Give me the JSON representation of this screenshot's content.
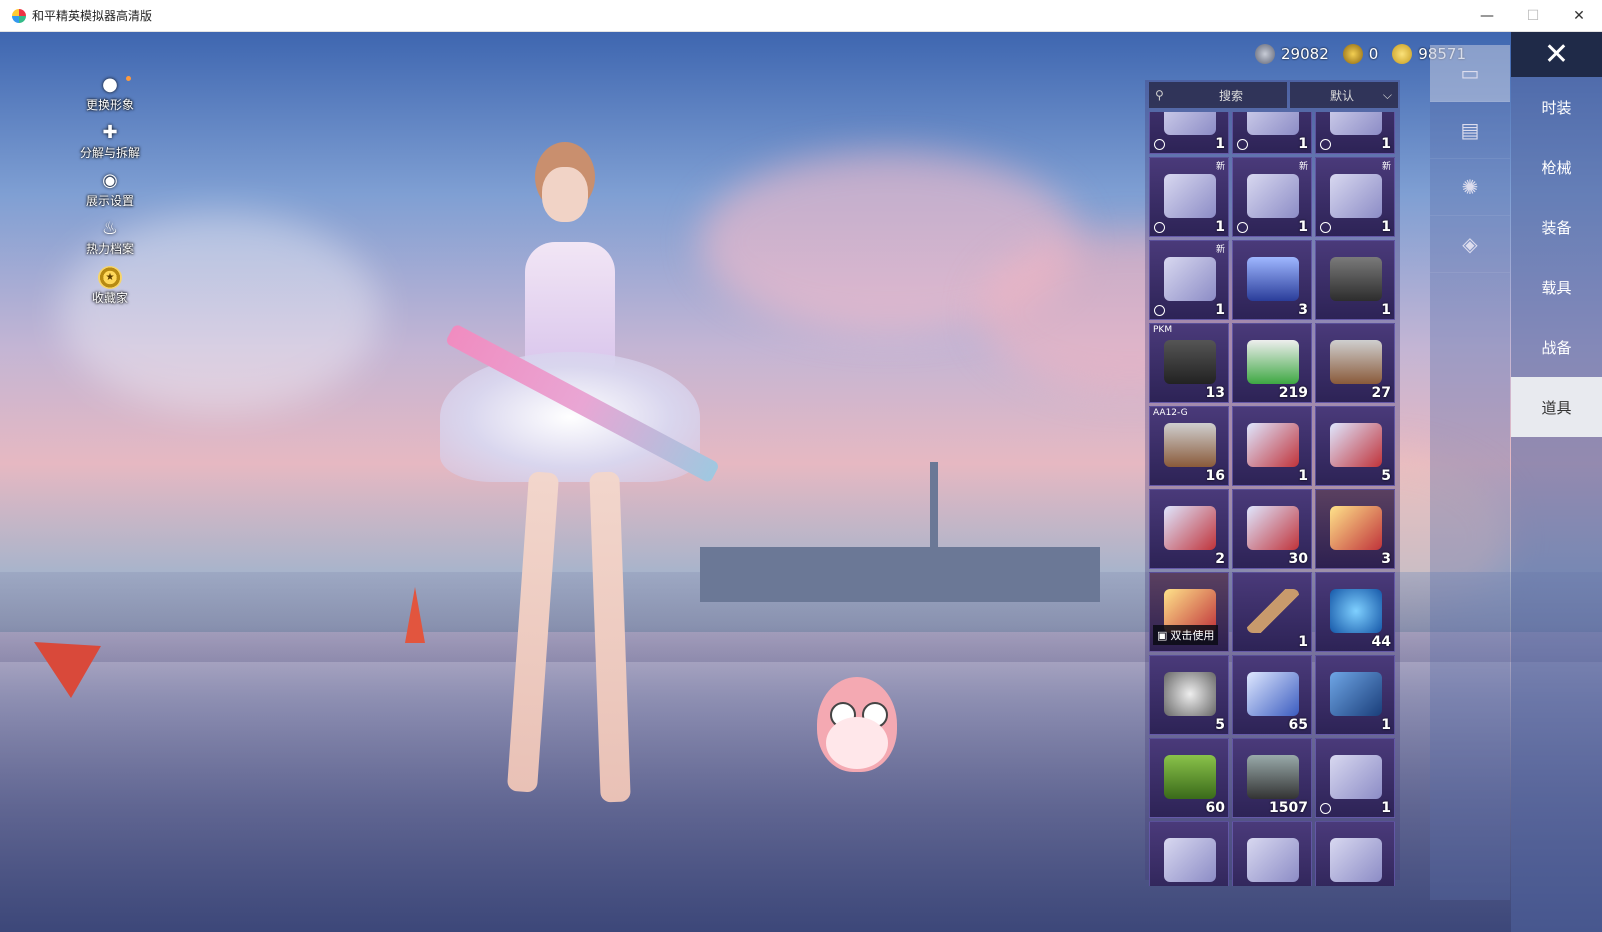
{
  "window": {
    "title": "和平精英模拟器高清版",
    "minimize": "—",
    "maximize": "☐",
    "close": "✕"
  },
  "currency": [
    {
      "icon": "silver-coin-icon",
      "value": "29082",
      "color": "#8a8fa0"
    },
    {
      "icon": "gold-token-icon",
      "value": "0",
      "color": "#d6a520"
    },
    {
      "icon": "bp-coin-icon",
      "value": "98571",
      "color": "#e8c23a"
    }
  ],
  "left_tools": [
    {
      "name": "change-appearance",
      "label": "更换形象",
      "icon": "person-icon"
    },
    {
      "name": "decompose",
      "label": "分解与拆解",
      "icon": "puzzle-icon"
    },
    {
      "name": "display-settings",
      "label": "展示设置",
      "icon": "eye-icon"
    },
    {
      "name": "heat-archive",
      "label": "热力档案",
      "icon": "flame-icon"
    },
    {
      "name": "collector",
      "label": "收藏家",
      "icon": "collector-badge-icon"
    }
  ],
  "inventory": {
    "search_placeholder": "搜索",
    "sort_label": "默认",
    "double_click_hint": "双击使用",
    "rows": [
      [
        {
          "qty": "1",
          "clock": true,
          "art": "ticket"
        },
        {
          "qty": "1",
          "clock": true,
          "art": "ticket"
        },
        {
          "qty": "1",
          "clock": true,
          "art": "ticket"
        }
      ],
      [
        {
          "qty": "1",
          "clock": true,
          "new": "新",
          "art": "ticket"
        },
        {
          "qty": "1",
          "clock": true,
          "new": "新",
          "art": "ticket"
        },
        {
          "qty": "1",
          "clock": true,
          "new": "新",
          "art": "ticket"
        }
      ],
      [
        {
          "qty": "1",
          "clock": true,
          "new": "新",
          "art": "ticket"
        },
        {
          "qty": "3",
          "art": "spray-can"
        },
        {
          "qty": "1",
          "art": "toolbox"
        }
      ],
      [
        {
          "qty": "13",
          "tag": "PKM",
          "art": "spring"
        },
        {
          "qty": "219",
          "art": "green-can"
        },
        {
          "qty": "27",
          "art": "crate"
        }
      ],
      [
        {
          "qty": "16",
          "tag": "AA12-G",
          "art": "crate"
        },
        {
          "qty": "1",
          "art": "exp-card"
        },
        {
          "qty": "5",
          "art": "exp-card"
        }
      ],
      [
        {
          "qty": "2",
          "art": "exp-card"
        },
        {
          "qty": "30",
          "art": "exp-card"
        },
        {
          "qty": "3",
          "art": "gold-exp-card"
        }
      ],
      [
        {
          "qty": "",
          "art": "gold-exp-card",
          "hint": true
        },
        {
          "qty": "1",
          "art": "bat"
        },
        {
          "qty": "44",
          "art": "puzzle-orb"
        }
      ],
      [
        {
          "qty": "5",
          "art": "bolt"
        },
        {
          "qty": "65",
          "art": "diamond"
        },
        {
          "qty": "1",
          "art": "card"
        }
      ],
      [
        {
          "qty": "60",
          "art": "fuel-can"
        },
        {
          "qty": "1507",
          "art": "spray-gun"
        },
        {
          "qty": "1",
          "clock": true,
          "art": "ticket"
        }
      ],
      [
        {
          "qty": "",
          "art": "ticket"
        },
        {
          "qty": "",
          "art": "ticket"
        },
        {
          "qty": "",
          "art": "ticket"
        }
      ]
    ]
  },
  "category_icons": [
    "card-icon",
    "chest-icon",
    "sparkle-icon",
    "ticket-icon"
  ],
  "categories": [
    {
      "label": "时装",
      "active": false
    },
    {
      "label": "枪械",
      "active": false
    },
    {
      "label": "装备",
      "active": false
    },
    {
      "label": "载具",
      "active": false
    },
    {
      "label": "战备",
      "active": false
    },
    {
      "label": "道具",
      "active": true
    }
  ]
}
